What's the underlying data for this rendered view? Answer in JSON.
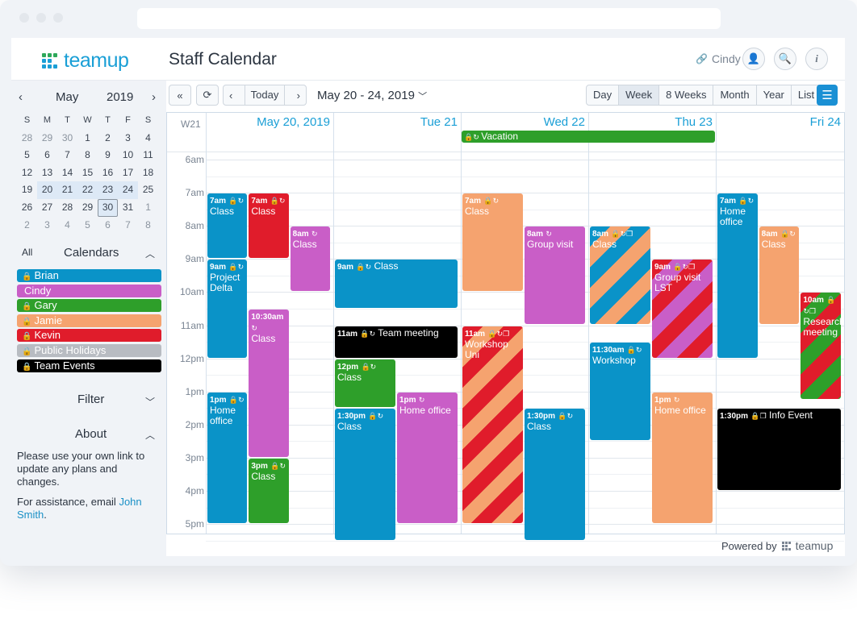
{
  "app": {
    "brand": "teamup",
    "title": "Staff Calendar",
    "user": "Cindy"
  },
  "sidebar": {
    "month": "May",
    "year": "2019",
    "weekdays": [
      "S",
      "M",
      "T",
      "W",
      "T",
      "F",
      "S"
    ],
    "weeks": [
      [
        "28",
        "29",
        "30",
        "1",
        "2",
        "3",
        "4"
      ],
      [
        "5",
        "6",
        "7",
        "8",
        "9",
        "10",
        "11"
      ],
      [
        "12",
        "13",
        "14",
        "15",
        "16",
        "17",
        "18"
      ],
      [
        "19",
        "20",
        "21",
        "22",
        "23",
        "24",
        "25"
      ],
      [
        "26",
        "27",
        "28",
        "29",
        "30",
        "31",
        "1"
      ],
      [
        "2",
        "3",
        "4",
        "5",
        "6",
        "7",
        "8"
      ]
    ],
    "all_label": "All",
    "calendars_label": "Calendars",
    "calendars": [
      {
        "name": "Brian",
        "color": "#0a93c8",
        "locked": true
      },
      {
        "name": "Cindy",
        "color": "#c95ec7",
        "locked": false
      },
      {
        "name": "Gary",
        "color": "#2e9f2a",
        "locked": true
      },
      {
        "name": "Jamie",
        "color": "#f5a36f",
        "locked": true
      },
      {
        "name": "Kevin",
        "color": "#e01c2b",
        "locked": true
      },
      {
        "name": "Public Holidays",
        "color": "#b8bcc2",
        "locked": true
      },
      {
        "name": "Team Events",
        "color": "#000000",
        "locked": true
      }
    ],
    "filter_label": "Filter",
    "about_label": "About",
    "about_text": "Please use your own link to update any plans and changes.",
    "assist_prefix": "For assistance, email ",
    "assist_link": "John Smith",
    "assist_suffix": "."
  },
  "toolbar": {
    "today": "Today",
    "range": "May 20 - 24, 2019",
    "views": [
      "Day",
      "Week",
      "8 Weeks",
      "Month",
      "Year",
      "List"
    ],
    "active_view": "Week"
  },
  "grid": {
    "week_label": "W21",
    "days": [
      "May 20, 2019",
      "Tue 21",
      "Wed 22",
      "Thu 23",
      "Fri 24"
    ],
    "hours": [
      "6am",
      "7am",
      "8am",
      "9am",
      "10am",
      "11am",
      "12pm",
      "1pm",
      "2pm",
      "3pm",
      "4pm",
      "5pm"
    ],
    "allday": {
      "label": "Vacation",
      "color": "#2e9f2a"
    }
  },
  "events": [
    {
      "time": "7am",
      "title": "Class",
      "color": "#0a93c8",
      "icons": "🔒↻"
    },
    {
      "time": "7am",
      "title": "Class",
      "color": "#e01c2b",
      "icons": "🔒↻"
    },
    {
      "time": "8am",
      "title": "Class",
      "color": "#c95ec7",
      "icons": "↻"
    },
    {
      "time": "9am",
      "title": "Project Delta",
      "color": "#0a93c8",
      "icons": "🔒↻"
    },
    {
      "time": "10:30am",
      "title": "Class",
      "color": "#c95ec7",
      "icons": "↻"
    },
    {
      "time": "1pm",
      "title": "Home office",
      "color": "#0a93c8",
      "icons": "🔒↻"
    },
    {
      "time": "3pm",
      "title": "Class",
      "color": "#2e9f2a",
      "icons": "🔒↻"
    },
    {
      "time": "9am",
      "title": "Class",
      "color": "#0a93c8",
      "icons": "🔒↻"
    },
    {
      "time": "11am",
      "title": "Team meeting",
      "color": "#000000",
      "icons": "🔒↻"
    },
    {
      "time": "12pm",
      "title": "Class",
      "color": "#2e9f2a",
      "icons": "🔒↻"
    },
    {
      "time": "1pm",
      "title": "Home office",
      "color": "#c95ec7",
      "icons": "↻"
    },
    {
      "time": "1:30pm",
      "title": "Class",
      "color": "#0a93c8",
      "icons": "🔒↻"
    },
    {
      "time": "7am",
      "title": "Class",
      "color": "#f5a36f",
      "icons": "🔒↻"
    },
    {
      "time": "8am",
      "title": "Group visit",
      "color": "#c95ec7",
      "icons": "↻"
    },
    {
      "time": "11am",
      "title": "Workshop Uni",
      "color": "#e01c2b",
      "icons": "🔒↻❐"
    },
    {
      "time": "1:30pm",
      "title": "Class",
      "color": "#0a93c8",
      "icons": "🔒↻"
    },
    {
      "time": "8am",
      "title": "Class",
      "color": "#0a93c8",
      "icons": "🔒↻❐"
    },
    {
      "time": "9am",
      "title": "Group visit LST",
      "color": "#e01c2b",
      "icons": "🔒↻❐"
    },
    {
      "time": "11:30am",
      "title": "Workshop",
      "color": "#0a93c8",
      "icons": "🔒↻"
    },
    {
      "time": "1pm",
      "title": "Home office",
      "color": "#f5a36f",
      "icons": "↻"
    },
    {
      "time": "7am",
      "title": "Home office",
      "color": "#0a93c8",
      "icons": "🔒↻"
    },
    {
      "time": "8am",
      "title": "Class",
      "color": "#f5a36f",
      "icons": "🔒↻"
    },
    {
      "time": "10am",
      "title": "Research meeting",
      "color": "#e01c2b",
      "icons": "🔒↻❐"
    },
    {
      "time": "1:30pm",
      "title": "Info Event",
      "color": "#000000",
      "icons": "🔒❐"
    }
  ],
  "footer": {
    "powered": "Powered by",
    "brand": "teamup"
  }
}
